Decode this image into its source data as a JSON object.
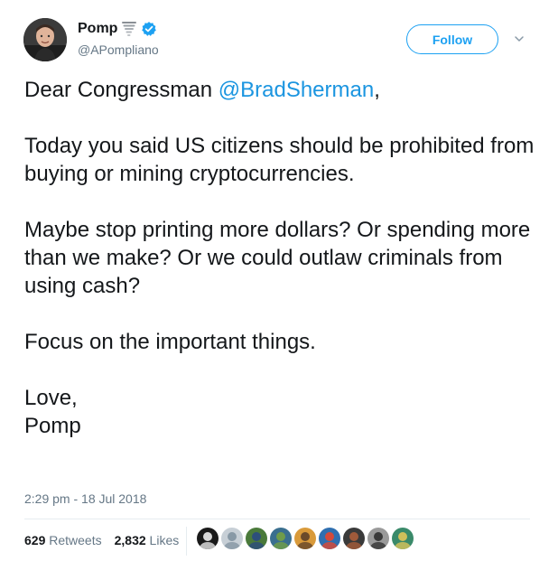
{
  "user": {
    "name": "Pomp",
    "handle": "@APompliano",
    "verified": true,
    "name_emoji": "tornado-icon"
  },
  "actions": {
    "follow_label": "Follow",
    "caret": "chevron-down-icon"
  },
  "tweet": {
    "greeting_prefix": "Dear Congressman ",
    "mention": "@BradSherman",
    "greeting_suffix": ",",
    "paragraph2": "Today you said US citizens should be prohibited from buying or mining cryptocurrencies.",
    "paragraph3": "Maybe stop printing more dollars? Or spending more than we make? Or we could outlaw criminals from using cash?",
    "paragraph4": "Focus on the important things.",
    "signoff_line1": "Love,",
    "signoff_line2": "Pomp"
  },
  "timestamp": "2:29 pm - 18 Jul 2018",
  "stats": {
    "retweets_count": "629",
    "retweets_label": "Retweets",
    "likes_count": "2,832",
    "likes_label": "Likes"
  },
  "likers": [
    {
      "name": "liker-avatar-1",
      "colors": [
        "#1a1a1a",
        "#d9d9d9"
      ]
    },
    {
      "name": "liker-avatar-2",
      "colors": [
        "#c7cfd6",
        "#8899a6"
      ]
    },
    {
      "name": "liker-avatar-3",
      "colors": [
        "#4a7a3a",
        "#2d4f7a"
      ]
    },
    {
      "name": "liker-avatar-4",
      "colors": [
        "#3a6f8f",
        "#6f9c4a"
      ]
    },
    {
      "name": "liker-avatar-5",
      "colors": [
        "#d99a3a",
        "#6b4a2a"
      ]
    },
    {
      "name": "liker-avatar-6",
      "colors": [
        "#2f6fb0",
        "#d44a3a"
      ]
    },
    {
      "name": "liker-avatar-7",
      "colors": [
        "#3a3a3a",
        "#a05a3a"
      ]
    },
    {
      "name": "liker-avatar-8",
      "colors": [
        "#9a9a9a",
        "#3a3a3a"
      ]
    },
    {
      "name": "liker-avatar-9",
      "colors": [
        "#3a8a6a",
        "#d0c05a"
      ]
    }
  ],
  "colors": {
    "accent": "#1da1f2",
    "mention": "#1b95e0",
    "muted": "#657786",
    "text": "#14171a"
  }
}
